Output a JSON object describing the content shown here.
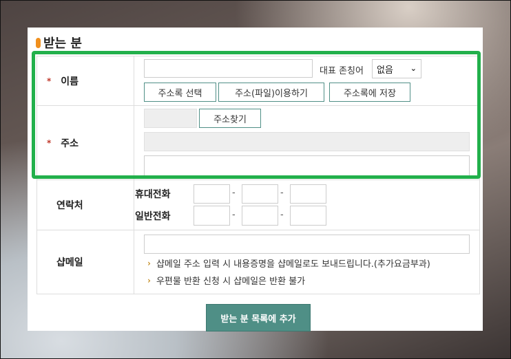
{
  "section": {
    "title": "받는 분"
  },
  "name_row": {
    "required_mark": "*",
    "label": "이름",
    "name_value": "",
    "honorific_label": "대표 존칭어",
    "honorific_selected": "없음",
    "buttons": [
      "주소록 선택",
      "주소(파일)이용하기",
      "주소록에 저장"
    ]
  },
  "address_row": {
    "required_mark": "*",
    "label": "주소",
    "zip_value": "",
    "search_button": "주소찾기",
    "address_value": "",
    "detail_value": ""
  },
  "contact_row": {
    "label": "연락처",
    "mobile_label": "휴대전화",
    "phone_label": "일반전화",
    "separator": "-"
  },
  "email_row": {
    "label": "샵메일",
    "email_value": "",
    "notices": [
      "샵메일 주소 입력 시 내용증명을 샵메일로도 보내드립니다.(추가요금부과)",
      "우편물 반환 신청 시 샵메일은 반환 불가"
    ]
  },
  "submit": {
    "label": "받는 분 목록에 추가"
  },
  "colors": {
    "accent": "#4f8f86",
    "highlight": "#22b04b",
    "marker": "#f0901e"
  }
}
